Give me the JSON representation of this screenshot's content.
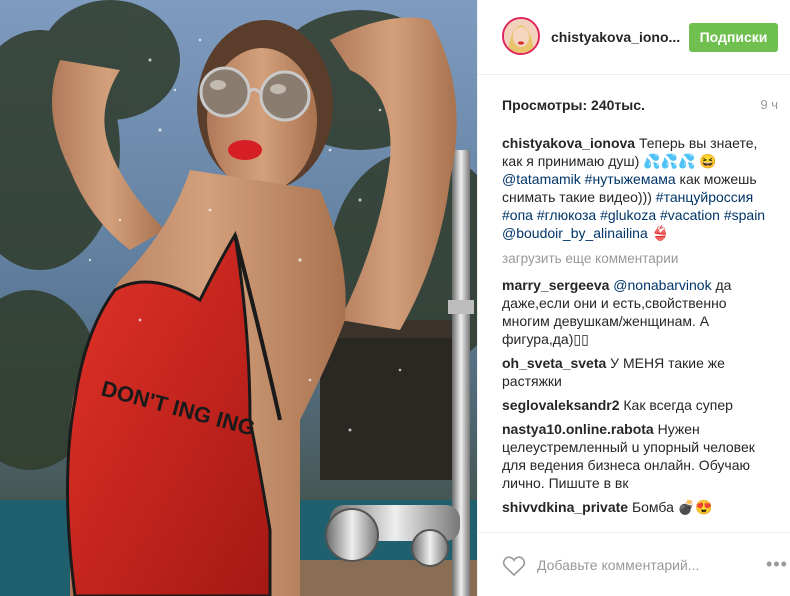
{
  "header": {
    "username": "chistyakova_iono...",
    "follow_label": "Подписки"
  },
  "stats": {
    "views": "Просмотры: 240тыс.",
    "time_ago": "9 ч"
  },
  "caption": {
    "author": "chistyakova_ionova",
    "text1": " Теперь вы знаете, как я принимаю душ) 💦💦💦 😆",
    "mention1": "@tatamamik",
    "hashtag1": " #нутыжемама",
    "text2": " как можешь снимать такие видео))) ",
    "hashtags2": "#танцуйроссия #опа #глюкоза #glukoza #vacation #spain",
    "mention2": " @boudoir_by_alinailina",
    "emoji_end": " 👙"
  },
  "load_more": "загрузить еще комментарии",
  "comments": [
    {
      "author": "marry_sergeeva",
      "mention": " @nonabarvinok",
      "text": " да даже,если они и есть,свойственно многим девушкам/женщинам. А фигура,да)▯▯"
    },
    {
      "author": "oh_sveta_sveta",
      "text": " У МЕНЯ такие же растяжки"
    },
    {
      "author": "seglovaleksandr2",
      "text": " Как всегда супер"
    },
    {
      "author": "nastya10.online.rabota",
      "text": " Нужен целеусᴛремленный u упорный человек для ведения бизнеса онлайн. Обучаю лично. Пишuᴛе в вк"
    },
    {
      "author": "shivvdkina_private",
      "text": " Бомба 💣😍"
    }
  ],
  "footer": {
    "add_comment_placeholder": "Добавьте комментарий...",
    "more_icon": "•••"
  },
  "media": {
    "suit_text": "DON'T  ING  ING"
  },
  "colors": {
    "follow_bg": "#70c050",
    "link": "#003569",
    "muted": "#999999",
    "swimsuit": "#d9251f"
  }
}
